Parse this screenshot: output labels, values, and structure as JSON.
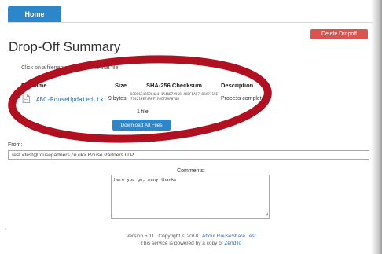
{
  "nav": {
    "home_label": "Home"
  },
  "actions": {
    "delete_label": "Delete Dropoff",
    "download_all_label": "Download All Files"
  },
  "page": {
    "title": "Drop-Off Summary",
    "instructions": "Click on a filename to download that file."
  },
  "files_table": {
    "headers": {
      "filename": "Filename",
      "size": "Size",
      "checksum": "SHA-256 Checksum",
      "description": "Description"
    },
    "rows": [
      {
        "filename": "ABC-RouseUpdated.txt",
        "size": "9 bytes",
        "checksum": "83D06E43598424 1A46D72968 48EFEAF7 B8A7715E714219E74AFF1F6C72AF870D",
        "description": "Process complete"
      }
    ],
    "file_count": "1 file"
  },
  "from": {
    "label": "From:",
    "value": "Test <test@rousepartners.co.uk>  Rouse Partners LLP"
  },
  "comments": {
    "label": "Comments:",
    "value": "Here you go, many thanks"
  },
  "footer": {
    "version_prefix": "Version 5.11 | Copyright © 2018 | ",
    "version_link": "About RouseShare Test",
    "powered_prefix": "This service is powered by a copy of ",
    "powered_link": "ZendTo"
  },
  "annotation": {
    "color": "#b01020",
    "shape": "ellipse"
  },
  "colors": {
    "primary": "#2d86c9",
    "danger": "#d9534f",
    "link": "#2a6db0"
  }
}
